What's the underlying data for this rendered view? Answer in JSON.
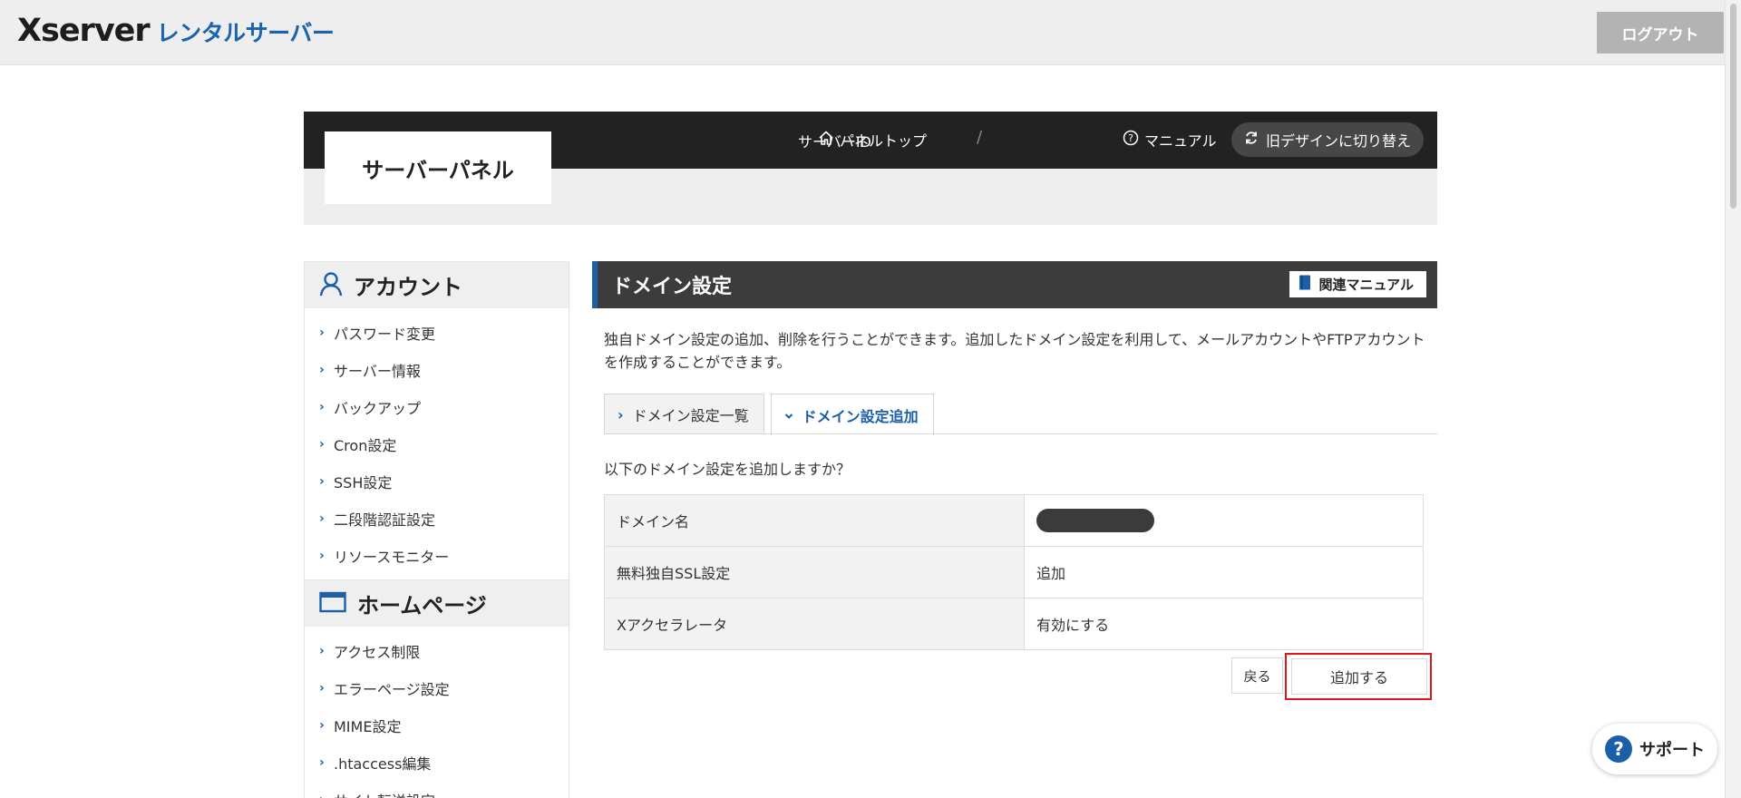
{
  "header": {
    "logo_main": "Xserver",
    "logo_sub": "レンタルサーバー",
    "logout_label": "ログアウト"
  },
  "panel": {
    "title": "サーバーパネル",
    "server_id_label": "サーバーID",
    "separator": "/",
    "nav": {
      "panel_top": "パネルトップ",
      "manual": "マニュアル",
      "old_design": "旧デザインに切り替え"
    }
  },
  "sidebar": {
    "account": {
      "heading": "アカウント",
      "items": [
        "パスワード変更",
        "サーバー情報",
        "バックアップ",
        "Cron設定",
        "SSH設定",
        "二段階認証設定",
        "リソースモニター"
      ]
    },
    "homepage": {
      "heading": "ホームページ",
      "items": [
        "アクセス制限",
        "エラーページ設定",
        "MIME設定",
        ".htaccess編集",
        "サイト転送設定"
      ]
    }
  },
  "main": {
    "section_title": "ドメイン設定",
    "manual_button": "関連マニュアル",
    "description": "独自ドメイン設定の追加、削除を行うことができます。追加したドメイン設定を利用して、メールアカウントやFTPアカウントを作成することができます。",
    "tabs": [
      {
        "label": "ドメイン設定一覧",
        "active": false
      },
      {
        "label": "ドメイン設定追加",
        "active": true
      }
    ],
    "confirm_text": "以下のドメイン設定を追加しますか？",
    "rows": [
      {
        "label": "ドメイン名",
        "value": ""
      },
      {
        "label": "無料独自SSL設定",
        "value": "追加"
      },
      {
        "label": "Xアクセラレータ",
        "value": "有効にする"
      }
    ],
    "back_button": "戻る",
    "add_button": "追加する"
  },
  "support": {
    "label": "サポート"
  },
  "colors": {
    "accent": "#1a5fa8",
    "highlight": "#e0161e",
    "dark_bar": "#222222"
  }
}
